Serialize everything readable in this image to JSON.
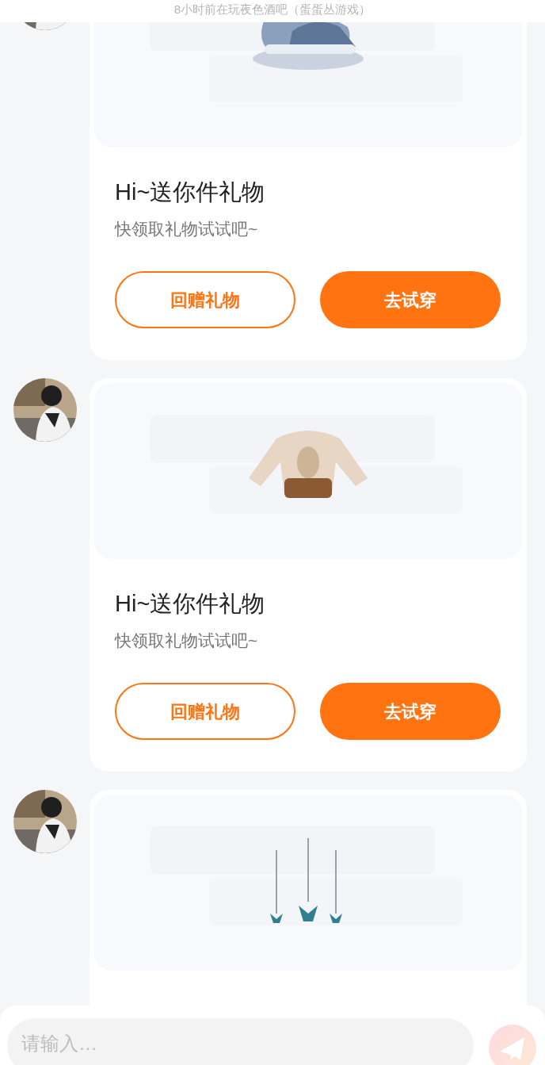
{
  "header": {
    "status": "8小时前在玩夜色酒吧（蛋蛋丛游戏）"
  },
  "messages": [
    {
      "kind": "gift",
      "title": "Hi~送你件礼物",
      "subtitle": "快领取礼物试试吧~",
      "buttons": [
        {
          "label": "回赠礼物",
          "kind": "outline"
        },
        {
          "label": "去试穿",
          "kind": "filled"
        }
      ]
    },
    {
      "kind": "gift",
      "title": "Hi~送你件礼物",
      "subtitle": "快领取礼物试试吧~",
      "buttons": [
        {
          "label": "回赠礼物",
          "kind": "outline"
        },
        {
          "label": "去试穿",
          "kind": "filled"
        }
      ]
    },
    {
      "kind": "gift"
    }
  ],
  "composer": {
    "placeholder": "请输入…"
  }
}
